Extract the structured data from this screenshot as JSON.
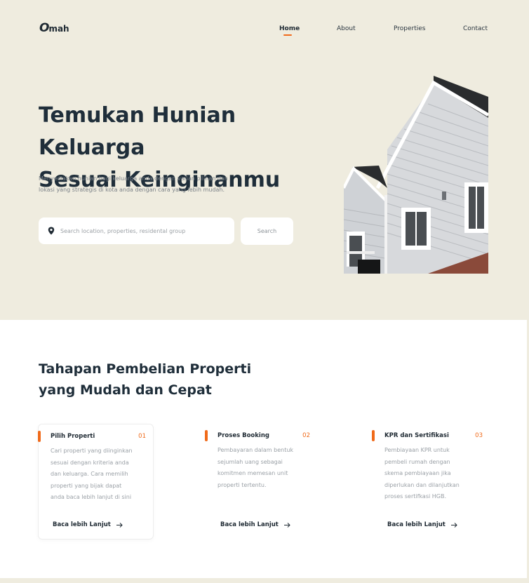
{
  "logo": {
    "mark": "O",
    "rest": "mah"
  },
  "nav": {
    "items": [
      {
        "label": "Home",
        "active": true
      },
      {
        "label": "About",
        "active": false
      },
      {
        "label": "Properties",
        "active": false
      },
      {
        "label": "Contact",
        "active": false
      }
    ]
  },
  "hero": {
    "title_line1": "Temukan Hunian Keluarga",
    "title_line2": "Sesuai Keinginanmu",
    "desc_line1": "Menyediakan hunian bagi keluarga anda dengan varian pilihan dan",
    "desc_line2": "lokasi yang strategis di kota anda dengan cara yang lebih mudah.",
    "search_placeholder": "Search location, properties, residental group",
    "search_button": "Search"
  },
  "steps": {
    "title_line1": "Tahapan Pembelian Properti",
    "title_line2": "yang Mudah dan Cepat",
    "cards": [
      {
        "title": "Pilih Properti",
        "number": "01",
        "lines": [
          "Cari properti yang diinginkan",
          "sesuai dengan kriteria anda",
          "dan keluarga. Cara memilih",
          "properti yang bijak dapat",
          "anda baca lebih lanjut di sini"
        ],
        "link": "Baca lebih Lanjut"
      },
      {
        "title": "Proses Booking",
        "number": "02",
        "lines": [
          "Pembayaran dalam bentuk",
          "sejumlah uang sebagai",
          "komitmen memesan unit",
          "properti tertentu."
        ],
        "link": "Baca lebih Lanjut"
      },
      {
        "title": "KPR dan Sertifikasi",
        "number": "03",
        "lines": [
          "Pembiayaan KPR untuk",
          "pembeli rumah dengan",
          "skema pembiayaan jika",
          "diperlukan dan dilanjutkan",
          "proses sertifkasi HGB."
        ],
        "link": "Baca lebih Lanjut"
      }
    ]
  },
  "colors": {
    "background": "#EFECDF",
    "accent": "#F06A1A",
    "text_dark": "#1F2E3A",
    "text_muted": "#9AA0A6"
  },
  "icons": {
    "search": "map-pin-icon",
    "link": "arrow-right-icon"
  }
}
